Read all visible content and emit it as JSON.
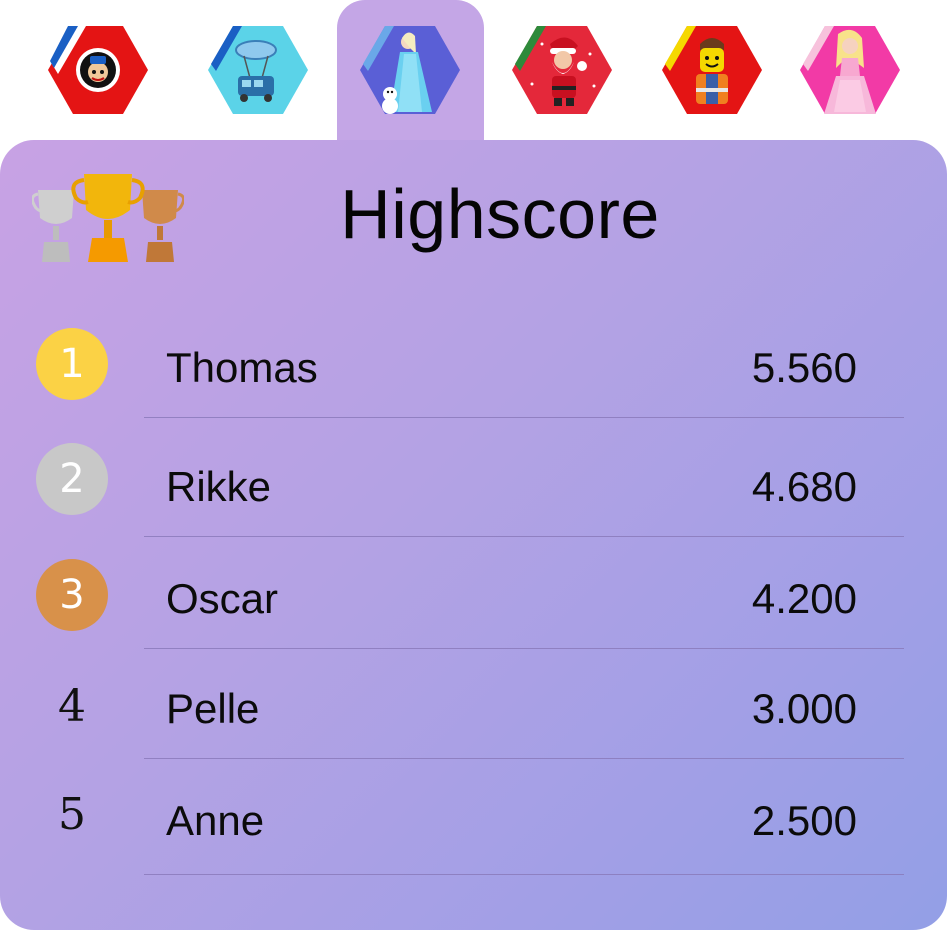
{
  "tabs": [
    {
      "theme": "paw-patrol",
      "icon": "mighty-pups-badge-icon",
      "color": "#e41414",
      "stripe": "#1a5fc4",
      "active": false
    },
    {
      "theme": "fortnite",
      "icon": "battle-bus-icon",
      "color": "#5bd3e8",
      "stripe": "#1a5fc4",
      "active": false
    },
    {
      "theme": "frozen",
      "icon": "elsa-olaf-icon",
      "color": "#5a5fd6",
      "stripe": "#6aa8e8",
      "active": true
    },
    {
      "theme": "christmas",
      "icon": "santa-claus-icon",
      "color": "#e4283a",
      "stripe": "#2e8a3a",
      "active": false
    },
    {
      "theme": "lego",
      "icon": "lego-minifigure-icon",
      "color": "#e41414",
      "stripe": "#f5d800",
      "active": false
    },
    {
      "theme": "barbie",
      "icon": "barbie-doll-icon",
      "color": "#f23aa6",
      "stripe": "#f7c2dc",
      "active": false
    }
  ],
  "header": {
    "title": "Highscore",
    "icon": "trophies-icon"
  },
  "medal_colors": {
    "gold": "#fbd245",
    "silver": "#c8c8c8",
    "bronze": "#d8914a"
  },
  "scores": [
    {
      "rank": "1",
      "name": "Thomas",
      "score": "5.560",
      "medal": "gold"
    },
    {
      "rank": "2",
      "name": "Rikke",
      "score": "4.680",
      "medal": "silver"
    },
    {
      "rank": "3",
      "name": "Oscar",
      "score": "4.200",
      "medal": "bronze"
    },
    {
      "rank": "4",
      "name": "Pelle",
      "score": "3.000",
      "medal": ""
    },
    {
      "rank": "5",
      "name": "Anne",
      "score": "2.500",
      "medal": ""
    }
  ]
}
